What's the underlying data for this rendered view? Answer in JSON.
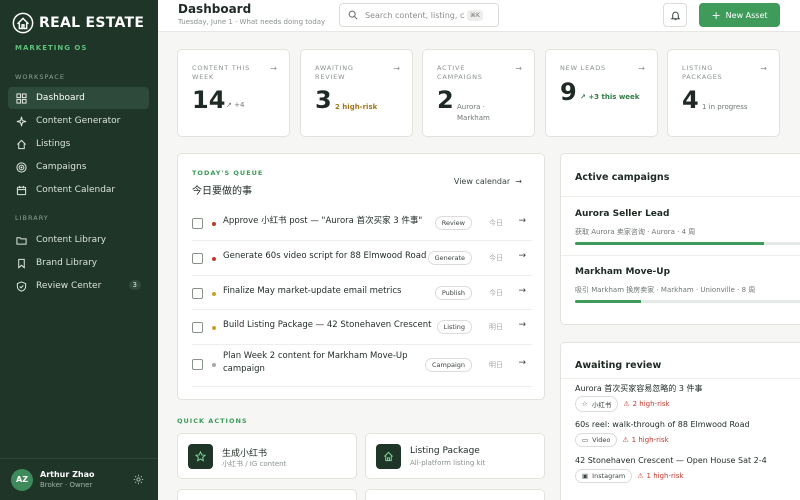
{
  "brand": {
    "name": "REAL ESTATE",
    "tagline": "MARKETING OS"
  },
  "sidebar": {
    "workspace_label": "WORKSPACE",
    "library_label": "LIBRARY",
    "workspace_items": [
      {
        "label": "Dashboard",
        "icon": "grid-icon"
      },
      {
        "label": "Content Generator",
        "icon": "sparkle-icon"
      },
      {
        "label": "Listings",
        "icon": "home-icon"
      },
      {
        "label": "Campaigns",
        "icon": "target-icon"
      },
      {
        "label": "Content Calendar",
        "icon": "calendar-icon"
      }
    ],
    "library_items": [
      {
        "label": "Content Library",
        "icon": "folder-icon"
      },
      {
        "label": "Brand Library",
        "icon": "bookmark-icon"
      },
      {
        "label": "Review Center",
        "icon": "shield-icon",
        "badge": "3"
      }
    ]
  },
  "user": {
    "initials": "AZ",
    "name": "Arthur Zhao",
    "role": "Broker · Owner"
  },
  "header": {
    "title": "Dashboard",
    "subtitle": "Tuesday, June 1 · What needs doing today",
    "search_placeholder": "Search content, listing, campaign",
    "search_shortcut": "⌘K",
    "new_asset_label": "New Asset"
  },
  "stats": [
    {
      "label": "CONTENT THIS WEEK",
      "value": "14",
      "note": "+4"
    },
    {
      "label": "AWAITING REVIEW",
      "value": "3",
      "note": "2 high-risk"
    },
    {
      "label": "ACTIVE CAMPAIGNS",
      "value": "2",
      "note": "Aurora · Markham"
    },
    {
      "label": "NEW LEADS",
      "value": "9",
      "note": "+3 this week"
    },
    {
      "label": "LISTING PACKAGES",
      "value": "4",
      "note": "1 in progress"
    }
  ],
  "queue": {
    "eyebrow": "TODAY'S QUEUE",
    "title": "今日要做的事",
    "view_calendar": "View calendar",
    "tasks": [
      {
        "title": "Approve 小红书 post — \"Aurora 首次买家 3 件事\"",
        "tag": "Review",
        "day": "今日",
        "dot": "#c0392b"
      },
      {
        "title": "Generate 60s video script for 88 Elmwood Road",
        "tag": "Generate",
        "day": "今日",
        "dot": "#c0392b"
      },
      {
        "title": "Finalize May market-update email metrics",
        "tag": "Publish",
        "day": "今日",
        "dot": "#c9a227"
      },
      {
        "title": "Build Listing Package — 42 Stonehaven Crescent",
        "tag": "Listing",
        "day": "明日",
        "dot": "#c9a227"
      },
      {
        "title": "Plan Week 2 content for Markham Move-Up campaign",
        "tag": "Campaign",
        "day": "明日",
        "dot": "#a5aba7"
      }
    ]
  },
  "quick_actions": {
    "label": "QUICK ACTIONS",
    "items": [
      {
        "title": "生成小红书",
        "sub": "小红书 / IG content"
      },
      {
        "title": "Listing Package",
        "sub": "All-platform listing kit"
      }
    ]
  },
  "campaigns": {
    "title": "Active campaigns",
    "items": [
      {
        "name": "Aurora Seller Lead",
        "sub": "获取 Aurora 卖家咨询 · Aurora · 4 周",
        "progress": 0.8
      },
      {
        "name": "Markham Move-Up",
        "sub": "吸引 Markham 换房卖家 · Markham · Unionville · 8 周",
        "progress": 0.28
      }
    ]
  },
  "review": {
    "title": "Awaiting review",
    "items": [
      {
        "title": "Aurora 首次买家容易忽略的 3 件事",
        "platform": "小红书",
        "risk": "2 high-risk"
      },
      {
        "title": "60s reel: walk-through of 88 Elmwood Road",
        "platform": "Video",
        "risk": "1 high-risk"
      },
      {
        "title": "42 Stonehaven Crescent — Open House Sat 2-4",
        "platform": "Instagram",
        "risk": "1 high-risk"
      }
    ]
  },
  "colors": {
    "sidebar": "#1e3528",
    "accent": "#3e9b5a",
    "risk": "#c0392b",
    "warning": "#a0771a"
  }
}
